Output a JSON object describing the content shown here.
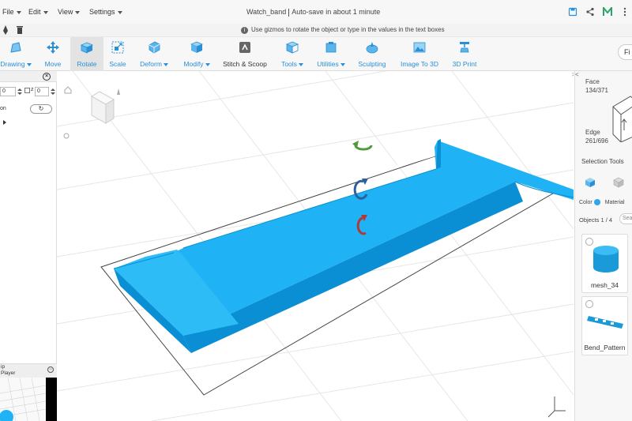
{
  "menu": {
    "items": [
      {
        "label": "File"
      },
      {
        "label": "Edit"
      },
      {
        "label": "View"
      },
      {
        "label": "Settings"
      }
    ]
  },
  "document": {
    "title": "Watch_band",
    "autosave": "Auto-save in about 1 minute"
  },
  "hint": {
    "text": "Use gizmos to rotate the object or type in the values in the text boxes"
  },
  "toolbar": {
    "tools": [
      {
        "label": "Drawing",
        "dropdown": true
      },
      {
        "label": "Move",
        "dropdown": false
      },
      {
        "label": "Rotate",
        "dropdown": false,
        "active": true
      },
      {
        "label": "Scale",
        "dropdown": false
      },
      {
        "label": "Deform",
        "dropdown": true
      },
      {
        "label": "Modify",
        "dropdown": true
      },
      {
        "label": "Stitch & Scoop",
        "dropdown": false
      },
      {
        "label": "Tools",
        "dropdown": true
      },
      {
        "label": "Utilities",
        "dropdown": true
      },
      {
        "label": "Sculpting",
        "dropdown": false
      },
      {
        "label": "Image To 3D",
        "dropdown": false
      },
      {
        "label": "3D Print",
        "dropdown": false
      }
    ],
    "find_label": "Fi"
  },
  "left_panel": {
    "field_values": [
      "0",
      "0"
    ],
    "axis_label_z": "z",
    "option_label": "on",
    "player_label_1": "ip",
    "player_label_2": "Player"
  },
  "right_panel": {
    "face_label": "Face",
    "face_count": "134/371",
    "edge_label": "Edge",
    "edge_count": "261/696",
    "selection_tools": "Selection Tools",
    "color_label": "Color",
    "material_label": "Material",
    "objects_count": "Objects 1 / 4",
    "search_placeholder": "Sea",
    "objects": [
      {
        "name": "mesh_34"
      },
      {
        "name": "Bend_Pattern"
      }
    ]
  },
  "colors": {
    "accent": "#2a8fd6",
    "model": "#1fb3f5",
    "model_dark": "#0a8ed4",
    "rotate_green": "#4f9a3a",
    "rotate_blue": "#2d5f9e",
    "rotate_red": "#b03a3a"
  }
}
